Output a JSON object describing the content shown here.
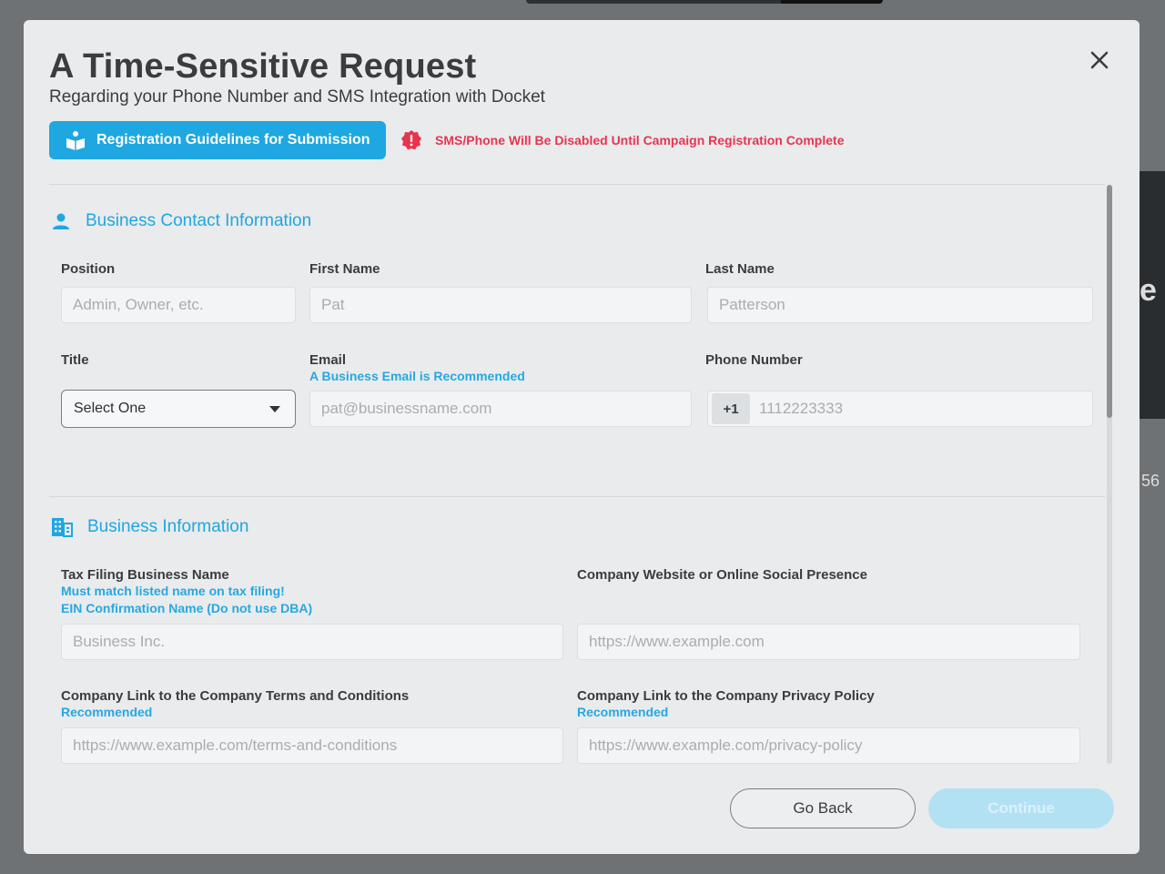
{
  "modal": {
    "title": "A Time-Sensitive Request",
    "subtitle": "Regarding your Phone Number and SMS Integration with Docket",
    "guidelines_button": "Registration Guidelines for Submission",
    "warning": "SMS/Phone Will Be Disabled Until Campaign Registration Complete"
  },
  "contact_section": {
    "heading": "Business Contact Information",
    "position": {
      "label": "Position",
      "placeholder": "Admin, Owner, etc."
    },
    "first_name": {
      "label": "First Name",
      "placeholder": "Pat"
    },
    "last_name": {
      "label": "Last Name",
      "placeholder": "Patterson"
    },
    "title_field": {
      "label": "Title",
      "value": "Select One"
    },
    "email": {
      "label": "Email",
      "hint": "A Business Email is Recommended",
      "placeholder": "pat@businessname.com"
    },
    "phone": {
      "label": "Phone Number",
      "prefix": "+1",
      "placeholder": "1112223333"
    }
  },
  "business_section": {
    "heading": "Business Information",
    "tax_name": {
      "label": "Tax Filing Business Name",
      "hint1": "Must match listed name on tax filing!",
      "hint2": "EIN Confirmation Name (Do not use DBA)",
      "placeholder": "Business Inc."
    },
    "website": {
      "label": "Company Website or Online Social Presence",
      "placeholder": "https://www.example.com"
    },
    "terms": {
      "label": "Company Link to the Company Terms and Conditions",
      "hint": "Recommended",
      "placeholder": "https://www.example.com/terms-and-conditions"
    },
    "privacy": {
      "label": "Company Link to the Company Privacy Policy",
      "hint": "Recommended",
      "placeholder": "https://www.example.com/privacy-policy"
    }
  },
  "footer": {
    "back_label": "Go Back",
    "continue_label": "Continue"
  },
  "background": {
    "partial_heading": "e",
    "partial_number": "56"
  },
  "colors": {
    "accent": "#1fa7e1",
    "warning": "#e8344e",
    "modal_bg": "#e9ebed",
    "continue_disabled": "#b3e1f4"
  },
  "icons": {
    "close": "close-icon",
    "guidelines": "book-reader-icon",
    "warning": "alert-badge-icon",
    "contact": "user-icon",
    "business": "building-icon",
    "select_caret": "caret-down-icon"
  }
}
